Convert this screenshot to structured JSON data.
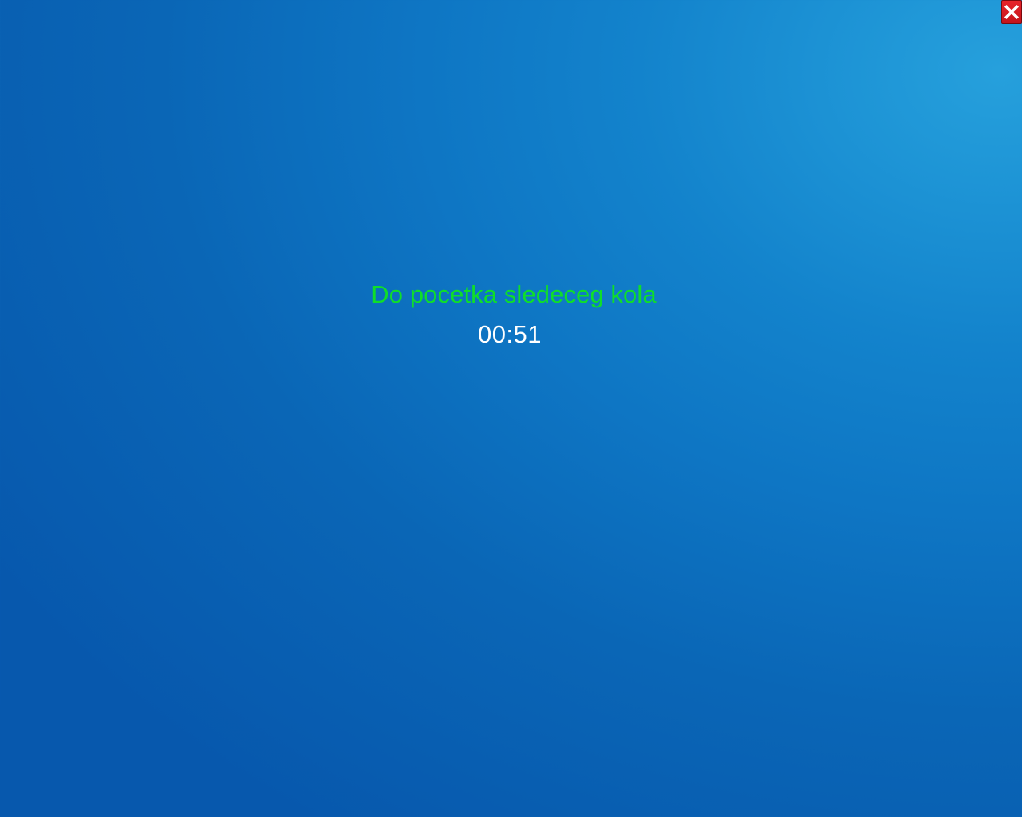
{
  "screen": {
    "background_colors": [
      "#26a0dc",
      "#0758ad"
    ]
  },
  "close_button": {
    "icon": "close-icon",
    "color": "#d41c22"
  },
  "countdown_panel": {
    "label": "Do pocetka sledeceg kola",
    "label_color": "#0fde2a",
    "timer": "00:51",
    "timer_color": "#ffffff"
  }
}
